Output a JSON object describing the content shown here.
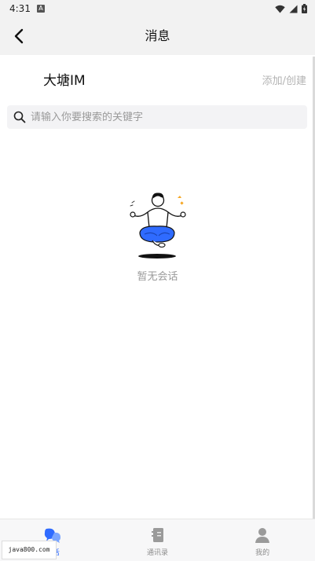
{
  "status_bar": {
    "time": "4:31",
    "notification_icon": "a-icon",
    "wifi_icon": "wifi-icon",
    "signal_icon": "signal-icon",
    "battery_icon": "battery-icon"
  },
  "nav": {
    "back_icon": "chevron-left-icon",
    "title": "消息"
  },
  "header": {
    "app_name": "大塘IM",
    "add_create": "添加/创建"
  },
  "search": {
    "icon": "search-icon",
    "placeholder": "请输入你要搜索的关键字",
    "value": ""
  },
  "empty_state": {
    "illustration": "meditating-person-illustration",
    "text": "暂无会话"
  },
  "tab_bar": {
    "tabs": [
      {
        "label": "会话",
        "icon": "chat-bubbles-icon",
        "active": true
      },
      {
        "label": "通讯录",
        "icon": "contacts-book-icon",
        "active": false
      },
      {
        "label": "我的",
        "icon": "person-icon",
        "active": false
      }
    ]
  },
  "watermark": {
    "text": "java800.com"
  },
  "colors": {
    "accent": "#2f6bff",
    "inactive": "#8c8c8c",
    "placeholder": "#9a9a9a",
    "nav_background": "#f2f2f2"
  }
}
